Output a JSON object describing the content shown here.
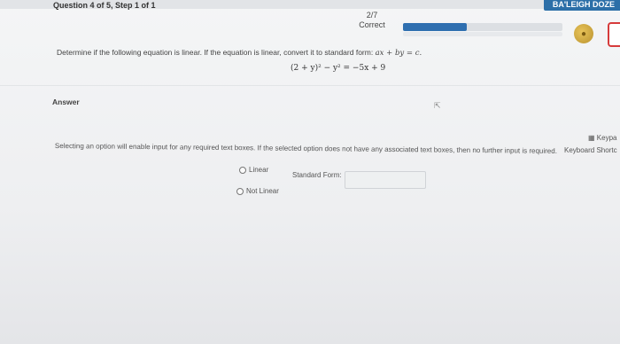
{
  "header": {
    "question_label": "Question 4 of 5, Step 1 of 1",
    "user_name": "BA'LEIGH DOZE",
    "score_value": "2/7",
    "score_status": "Correct",
    "progress_fraction": 0.4
  },
  "question": {
    "prompt": "Determine if the following equation is linear. If the equation is linear, convert it to standard form:",
    "standard_form": "ax + by = c.",
    "equation": "(2 + y)² − y² = −5x + 9"
  },
  "answer": {
    "label": "Answer",
    "keypad_label": "Keypa",
    "shortcuts_label": "Keyboard Shortc",
    "instructions": "Selecting an option will enable input for any required text boxes. If the selected option does not have any associated text boxes, then no further input is required.",
    "options": [
      {
        "label": "Linear"
      },
      {
        "label": "Not Linear"
      }
    ],
    "standard_form_label": "Standard Form:",
    "standard_form_value": ""
  }
}
